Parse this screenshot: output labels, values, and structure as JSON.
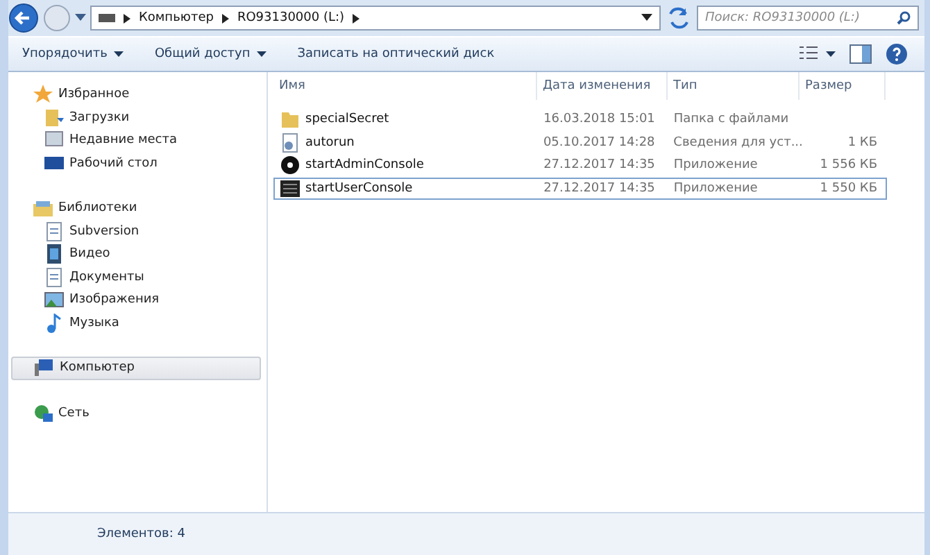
{
  "address": {
    "path": [
      "Компьютер",
      "RO93130000 (L:)"
    ],
    "search_placeholder": "Поиск: RO93130000 (L:)"
  },
  "toolbar": {
    "buttons": [
      {
        "label": "Упорядочить",
        "dropdown": true
      },
      {
        "label": "Общий доступ",
        "dropdown": true
      },
      {
        "label": "Записать на оптический диск",
        "dropdown": false
      }
    ]
  },
  "sidebar": {
    "groups": [
      {
        "label": "Избранное",
        "kind": "star",
        "selected": false,
        "children": [
          {
            "label": "Загрузки",
            "kind": "folder"
          },
          {
            "label": "Недавние места",
            "kind": "recent"
          },
          {
            "label": "Рабочий стол",
            "kind": "desktop"
          }
        ]
      },
      {
        "label": "Библиотеки",
        "kind": "library",
        "selected": false,
        "children": [
          {
            "label": "Subversion",
            "kind": "doc"
          },
          {
            "label": "Видео",
            "kind": "video"
          },
          {
            "label": "Документы",
            "kind": "doc"
          },
          {
            "label": "Изображения",
            "kind": "image"
          },
          {
            "label": "Музыка",
            "kind": "music"
          }
        ]
      },
      {
        "label": "Компьютер",
        "kind": "computer",
        "selected": true
      },
      {
        "label": "Сеть",
        "kind": "network",
        "selected": false
      }
    ]
  },
  "table": {
    "columns": [
      "Имя",
      "Дата изменения",
      "Тип",
      "Размер"
    ],
    "rows": [
      {
        "name": "specialSecret",
        "date": "16.03.2018 15:01",
        "type": "Папка с файлами",
        "kind": "folder",
        "selected": false
      },
      {
        "name": "autorun",
        "date": "05.10.2017 14:28",
        "type": "Сведения для уст...",
        "size": "1 КБ",
        "kind": "settings",
        "selected": false
      },
      {
        "name": "startAdminConsole",
        "date": "27.12.2017 14:35",
        "type": "Приложение",
        "size": "1 556 КБ",
        "kind": "disc",
        "selected": false
      },
      {
        "name": "startUserConsole",
        "date": "27.12.2017 14:35",
        "type": "Приложение",
        "size": "1 550 КБ",
        "kind": "console",
        "selected": true
      }
    ]
  },
  "details": {
    "count": "Элементов: 4"
  }
}
